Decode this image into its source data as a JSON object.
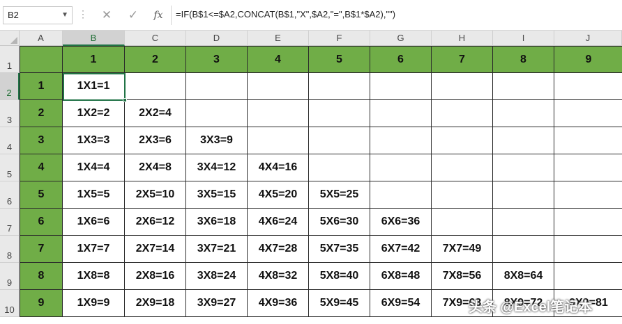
{
  "formula_bar": {
    "name_box": "B2",
    "cancel_icon": "✕",
    "confirm_icon": "✓",
    "fx_label": "fx",
    "formula": "=IF(B$1<=$A2,CONCAT(B$1,\"X\",$A2,\"=\",B$1*$A2),\"\")"
  },
  "columns": [
    "A",
    "B",
    "C",
    "D",
    "E",
    "F",
    "G",
    "H",
    "I",
    "J"
  ],
  "rows": [
    "1",
    "2",
    "3",
    "4",
    "5",
    "6",
    "7",
    "8",
    "9",
    "10"
  ],
  "header_row": [
    "",
    "1",
    "2",
    "3",
    "4",
    "5",
    "6",
    "7",
    "8",
    "9"
  ],
  "row_labels": [
    "1",
    "2",
    "3",
    "4",
    "5",
    "6",
    "7",
    "8",
    "9"
  ],
  "cells": [
    [
      "1X1=1",
      "",
      "",
      "",
      "",
      "",
      "",
      "",
      ""
    ],
    [
      "1X2=2",
      "2X2=4",
      "",
      "",
      "",
      "",
      "",
      "",
      ""
    ],
    [
      "1X3=3",
      "2X3=6",
      "3X3=9",
      "",
      "",
      "",
      "",
      "",
      ""
    ],
    [
      "1X4=4",
      "2X4=8",
      "3X4=12",
      "4X4=16",
      "",
      "",
      "",
      "",
      ""
    ],
    [
      "1X5=5",
      "2X5=10",
      "3X5=15",
      "4X5=20",
      "5X5=25",
      "",
      "",
      "",
      ""
    ],
    [
      "1X6=6",
      "2X6=12",
      "3X6=18",
      "4X6=24",
      "5X6=30",
      "6X6=36",
      "",
      "",
      ""
    ],
    [
      "1X7=7",
      "2X7=14",
      "3X7=21",
      "4X7=28",
      "5X7=35",
      "6X7=42",
      "7X7=49",
      "",
      ""
    ],
    [
      "1X8=8",
      "2X8=16",
      "3X8=24",
      "4X8=32",
      "5X8=40",
      "6X8=48",
      "7X8=56",
      "8X8=64",
      ""
    ],
    [
      "1X9=9",
      "2X9=18",
      "3X9=27",
      "4X9=36",
      "5X9=45",
      "6X9=54",
      "7X9=63",
      "8X9=72",
      "9X9=81"
    ]
  ],
  "selected_cell": "B2",
  "colors": {
    "header_fill": "#70ad47",
    "selection": "#217346"
  },
  "watermark": "头条 @Excel笔记本"
}
